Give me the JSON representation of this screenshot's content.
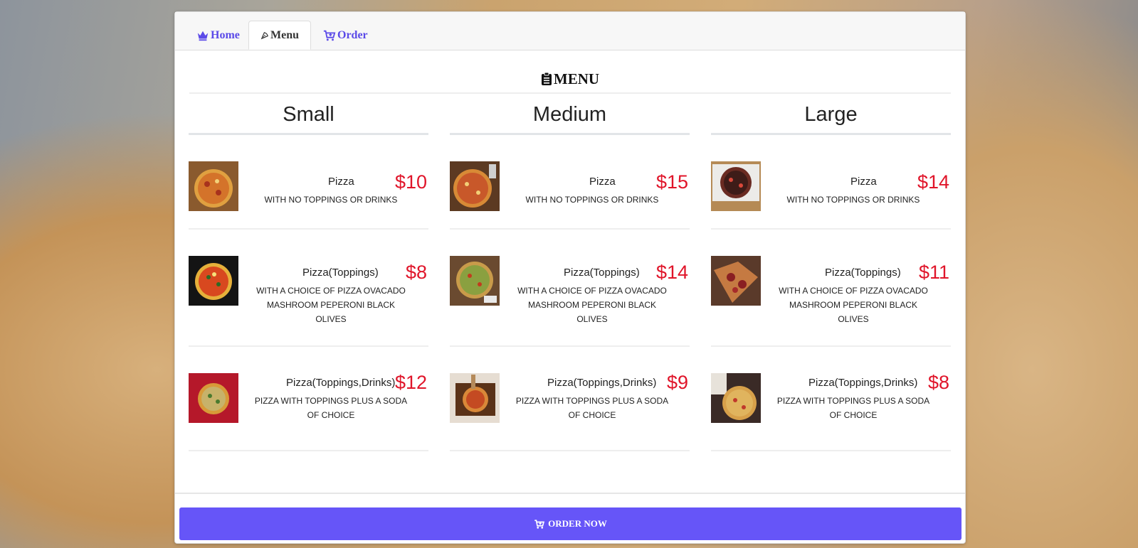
{
  "tabs": [
    {
      "label": "Home",
      "icon": "crown-icon"
    },
    {
      "label": "Menu",
      "icon": "pizza-slice-icon"
    },
    {
      "label": "Order",
      "icon": "cart-plus-icon"
    }
  ],
  "active_tab": "Menu",
  "menu_title": "MENU",
  "columns": [
    {
      "heading": "Small",
      "items": [
        {
          "name": "Pizza",
          "desc": "WITH NO TOPPINGS OR DRINKS",
          "price": "$10"
        },
        {
          "name": "Pizza(Toppings)",
          "desc": "WITH A CHOICE OF PIZZA OVACADO MASHROOM PEPERONI BLACK OLIVES",
          "price": "$8"
        },
        {
          "name": "Pizza(Toppings,Drinks)",
          "desc": "PIZZA WITH TOPPINGS PLUS A SODA OF CHOICE",
          "price": "$12"
        }
      ]
    },
    {
      "heading": "Medium",
      "items": [
        {
          "name": "Pizza",
          "desc": "WITH NO TOPPINGS OR DRINKS",
          "price": "$15"
        },
        {
          "name": "Pizza(Toppings)",
          "desc": "WITH A CHOICE OF PIZZA OVACADO MASHROOM PEPERONI BLACK OLIVES",
          "price": "$14"
        },
        {
          "name": "Pizza(Toppings,Drinks)",
          "desc": "PIZZA WITH TOPPINGS PLUS A SODA OF CHOICE",
          "price": "$9"
        }
      ]
    },
    {
      "heading": "Large",
      "items": [
        {
          "name": "Pizza",
          "desc": "WITH NO TOPPINGS OR DRINKS",
          "price": "$14"
        },
        {
          "name": "Pizza(Toppings)",
          "desc": "WITH A CHOICE OF PIZZA OVACADO MASHROOM PEPERONI BLACK OLIVES",
          "price": "$11"
        },
        {
          "name": "Pizza(Toppings,Drinks)",
          "desc": "PIZZA WITH TOPPINGS PLUS A SODA OF CHOICE",
          "price": "$8"
        }
      ]
    }
  ],
  "order_button": "ORDER NOW",
  "colors": {
    "accent": "#6655f8",
    "price": "#e0152a",
    "tab_link": "#5b4ae8"
  }
}
